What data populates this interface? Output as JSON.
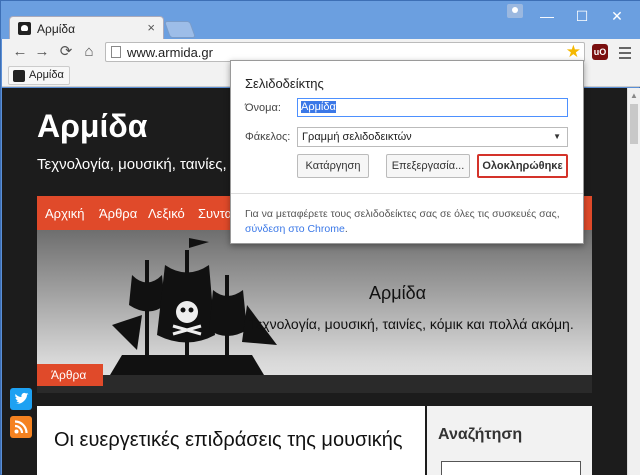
{
  "browser": {
    "tab_title": "Αρμίδα",
    "tab_close": "×",
    "url": "www.armida.gr",
    "bookmark_item": "Αρμίδα",
    "window_controls": {
      "minimize": "—",
      "maximize": "☐",
      "close": "✕"
    },
    "nav": {
      "back": "←",
      "forward": "→",
      "reload": "⟳",
      "home": "⌂"
    },
    "extension_badge": "uO",
    "star_icon": "★"
  },
  "bubble": {
    "title": "Σελιδοδείκτης",
    "name_label": "Όνομα:",
    "name_value": "Αρμίδα",
    "folder_label": "Φάκελος:",
    "folder_value": "Γραμμή σελιδοδεικτών",
    "remove_button": "Κατάργηση",
    "edit_button": "Επεξεργασία...",
    "done_button": "Ολοκληρώθηκε",
    "footer_text": "Για να μεταφέρετε τους σελιδοδείκτες σας σε όλες τις συσκευές σας,",
    "footer_link": "σύνδεση στο Chrome",
    "footer_end": "."
  },
  "site": {
    "title": "Αρμίδα",
    "tagline": "Τεχνολογία, μουσική, ταινίες, κό",
    "nav": [
      "Αρχική",
      "Άρθρα",
      "Λεξικό",
      "Συντα"
    ],
    "hero_title": "Αρμίδα",
    "hero_subtitle": "Τεχνολογία, μουσική, ταινίες, κόμικ και πολλά ακόμη.",
    "hero_tag": "Άρθρα",
    "post_title": "Οι ευεργετικές επιδράσεις της μουσικής",
    "sidebar_title": "Αναζήτηση"
  },
  "colors": {
    "accent": "#e04a2a",
    "link": "#3b78e7",
    "done_border": "#d4332a"
  }
}
